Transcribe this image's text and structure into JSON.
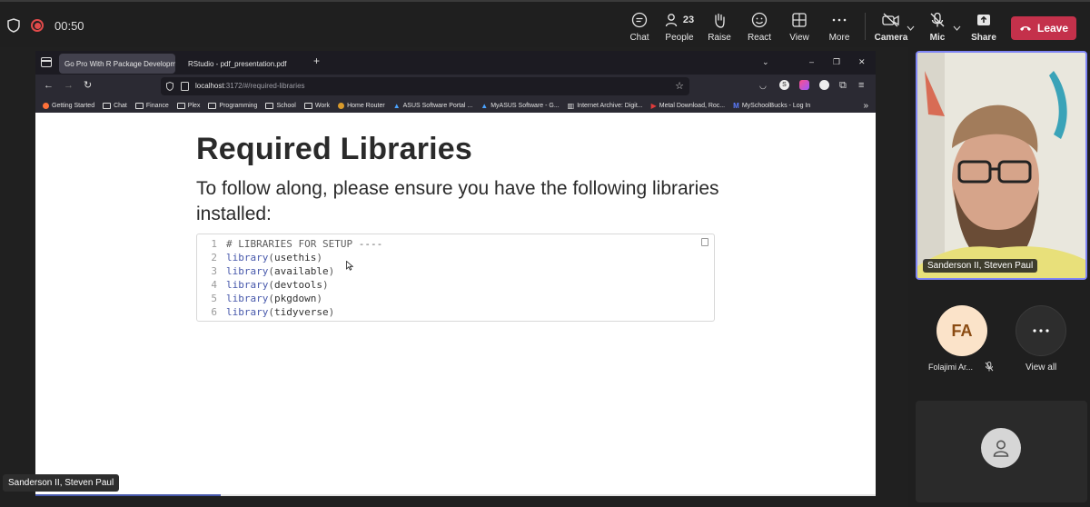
{
  "meeting": {
    "timer": "00:50",
    "controls": {
      "chat": "Chat",
      "people": "People",
      "people_count": "23",
      "raise": "Raise",
      "react": "React",
      "view": "View",
      "more": "More",
      "camera": "Camera",
      "mic": "Mic",
      "share": "Share",
      "leave": "Leave"
    },
    "presenter_label": "Sanderson II, Steven Paul"
  },
  "browser": {
    "tabs": [
      {
        "label": "Go Pro With R Package Developmen"
      },
      {
        "label": "RStudio - pdf_presentation.pdf"
      }
    ],
    "url_host": "localhost",
    "url_path": ":3172/#/required-libraries",
    "bookmarks": [
      "Getting Started",
      "Chat",
      "Finance",
      "Plex",
      "Programming",
      "School",
      "Work",
      "Home Router",
      "ASUS Software Portal ...",
      "MyASUS Software - G...",
      "Internet Archive: Digit...",
      "Metal Download, Roc...",
      "MySchoolBucks - Log In"
    ]
  },
  "slide": {
    "title": "Required Libraries",
    "intro": "To follow along, please ensure you have the following libraries installed:",
    "code": {
      "comment": "# LIBRARIES FOR SETUP ----",
      "fn": "library",
      "libraries": [
        "usethis",
        "available",
        "devtools",
        "pkgdown",
        "tidyverse"
      ],
      "line_numbers": [
        "1",
        "2",
        "3",
        "4",
        "5",
        "6"
      ]
    },
    "progress_fraction": 0.22
  },
  "participants": {
    "video_name": "Sanderson II, Steven Paul",
    "avatar_initials": "FA",
    "avatar_name": "Folajimi Ar...",
    "view_all": "View all"
  },
  "colors": {
    "leave": "#c4314b",
    "active_speaker_border": "#7f85f5",
    "code_fn": "#4758ab"
  }
}
